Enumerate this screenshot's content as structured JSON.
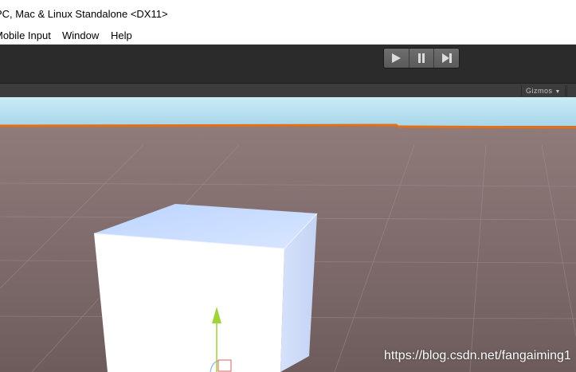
{
  "window": {
    "title": "PC, Mac & Linux Standalone <DX11>"
  },
  "menu": {
    "items": [
      "Mobile Input",
      "Window",
      "Help"
    ]
  },
  "toolbar": {
    "play_icon": "play-icon",
    "pause_icon": "pause-icon",
    "step_icon": "step-icon"
  },
  "scene_toolbar": {
    "gizmos_label": "Gizmos"
  },
  "watermark": "https://blog.csdn.net/fangaiming1",
  "colors": {
    "sky": "#bfe3f2",
    "horizon": "#e36f16",
    "ground": "#8a7676",
    "toolbar": "#2b2b2b"
  }
}
